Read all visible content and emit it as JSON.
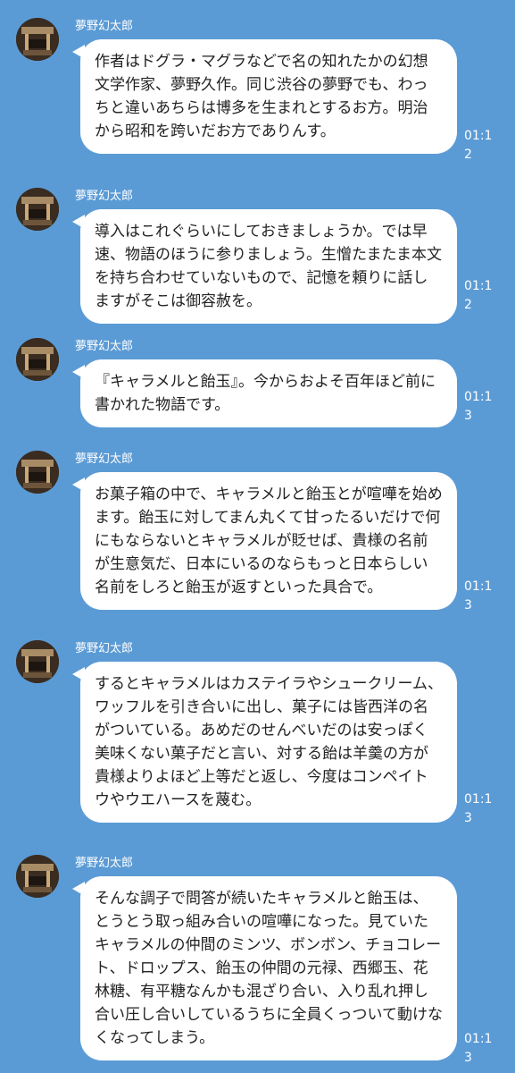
{
  "chat": {
    "messages": [
      {
        "sender": "夢野幻太郎",
        "text": "作者はドグラ・マグラなどで名の知れたかの幻想文学作家、夢野久作。同じ渋谷の夢野でも、わっちと違いあちらは博多を生まれとするお方。明治から昭和を跨いだお方でありんす。",
        "time": "01:12"
      },
      {
        "sender": "夢野幻太郎",
        "text": "導入はこれぐらいにしておきましょうか。では早速、物語のほうに参りましょう。生憎たまたま本文を持ち合わせていないもので、記憶を頼りに話しますがそこは御容赦を。",
        "time": "01:12"
      },
      {
        "sender": "夢野幻太郎",
        "text": "『キャラメルと飴玉』。今からおよそ百年ほど前に書かれた物語です。",
        "time": "01:13"
      },
      {
        "sender": "夢野幻太郎",
        "text": "お菓子箱の中で、キャラメルと飴玉とが喧嘩を始めます。飴玉に対してまん丸くて甘ったるいだけで何にもならないとキャラメルが貶せば、貴様の名前が生意気だ、日本にいるのならもっと日本らしい名前をしろと飴玉が返すといった具合で。",
        "time": "01:13"
      },
      {
        "sender": "夢野幻太郎",
        "text": "するとキャラメルはカステイラやシュークリーム、ワッフルを引き合いに出し、菓子には皆西洋の名がついている。あめだのせんべいだのは安っぽく美味くない菓子だと言い、対する飴は羊羹の方が貴様よりよほど上等だと返し、今度はコンペイトウやウエハースを蔑む。",
        "time": "01:13"
      },
      {
        "sender": "夢野幻太郎",
        "text": "そんな調子で問答が続いたキャラメルと飴玉は、とうとう取っ組み合いの喧嘩になった。見ていたキャラメルの仲間のミンツ、ボンボン、チョコレート、ドロップス、飴玉の仲間の元禄、西郷玉、花林糖、有平糖なんかも混ざり合い、入り乱れ押し合い圧し合いしているうちに全員くっついて動けなくなってしまう。",
        "time": "01:13"
      }
    ]
  },
  "colors": {
    "background": "#5b9bd5",
    "bubble": "#ffffff"
  },
  "icons": {
    "avatar": "avatar-photo"
  }
}
